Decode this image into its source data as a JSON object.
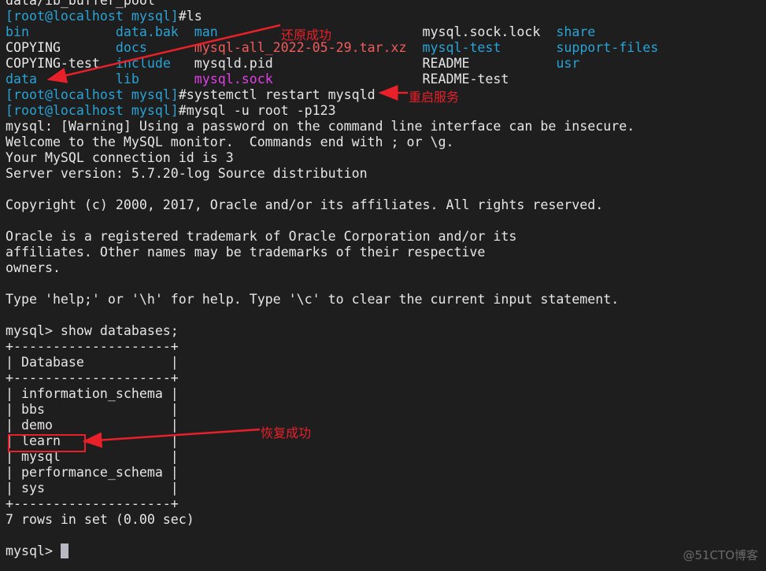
{
  "colors": {
    "background": "#1e1e1e",
    "white": "#e6e6e6",
    "blue": "#29a3d6",
    "red": "#f05c5c",
    "magenta": "#e23fe6",
    "annotation": "#e8202a"
  },
  "terminal": {
    "lines": [
      [
        [
          "data/ib_buffer_pool",
          "white"
        ]
      ],
      [
        [
          "[root@localhost mysql]",
          "blue"
        ],
        [
          "#ls",
          "white"
        ]
      ],
      [
        [
          "bin           ",
          "blue"
        ],
        [
          "data.bak  ",
          "blue"
        ],
        [
          "man                          ",
          "blue"
        ],
        [
          "mysql.sock.lock  ",
          "white"
        ],
        [
          "share",
          "blue"
        ]
      ],
      [
        [
          "COPYING       ",
          "white"
        ],
        [
          "docs      ",
          "blue"
        ],
        [
          "mysql-all_2022-05-29.tar.xz  ",
          "red"
        ],
        [
          "mysql-test       ",
          "blue"
        ],
        [
          "support-files",
          "blue"
        ]
      ],
      [
        [
          "COPYING-test  ",
          "white"
        ],
        [
          "include   ",
          "blue"
        ],
        [
          "mysqld.pid                   ",
          "white"
        ],
        [
          "README           ",
          "white"
        ],
        [
          "usr",
          "blue"
        ]
      ],
      [
        [
          "data          ",
          "blue"
        ],
        [
          "lib       ",
          "blue"
        ],
        [
          "mysql.sock                   ",
          "magenta"
        ],
        [
          "README-test",
          "white"
        ]
      ],
      [
        [
          "[root@localhost mysql]",
          "blue"
        ],
        [
          "#systemctl restart mysqld",
          "white"
        ]
      ],
      [
        [
          "[root@localhost mysql]",
          "blue"
        ],
        [
          "#mysql -u root -p123",
          "white"
        ]
      ],
      [
        [
          "mysql: [Warning] Using a password on the command line interface can be insecure.",
          "white"
        ]
      ],
      [
        [
          "Welcome to the MySQL monitor.  Commands end with ; or \\g.",
          "white"
        ]
      ],
      [
        [
          "Your MySQL connection id is 3",
          "white"
        ]
      ],
      [
        [
          "Server version: 5.7.20-log Source distribution",
          "white"
        ]
      ],
      [],
      [
        [
          "Copyright (c) 2000, 2017, Oracle and/or its affiliates. All rights reserved.",
          "white"
        ]
      ],
      [],
      [
        [
          "Oracle is a registered trademark of Oracle Corporation and/or its",
          "white"
        ]
      ],
      [
        [
          "affiliates. Other names may be trademarks of their respective",
          "white"
        ]
      ],
      [
        [
          "owners.",
          "white"
        ]
      ],
      [],
      [
        [
          "Type 'help;' or '\\h' for help. Type '\\c' to clear the current input statement.",
          "white"
        ]
      ],
      [],
      [
        [
          "mysql> show databases;",
          "white"
        ]
      ],
      [
        [
          "+--------------------+",
          "white"
        ]
      ],
      [
        [
          "| Database           |",
          "white"
        ]
      ],
      [
        [
          "+--------------------+",
          "white"
        ]
      ],
      [
        [
          "| information_schema |",
          "white"
        ]
      ],
      [
        [
          "| bbs                |",
          "white"
        ]
      ],
      [
        [
          "| demo               |",
          "white"
        ]
      ],
      [
        [
          "| learn              |",
          "white"
        ]
      ],
      [
        [
          "| mysql              |",
          "white"
        ]
      ],
      [
        [
          "| performance_schema |",
          "white"
        ]
      ],
      [
        [
          "| sys                |",
          "white"
        ]
      ],
      [
        [
          "+--------------------+",
          "white"
        ]
      ],
      [
        [
          "7 rows in set (0.00 sec)",
          "white"
        ]
      ],
      [],
      [
        [
          "mysql> ",
          "white"
        ]
      ]
    ]
  },
  "annotations": {
    "restore_success": "还原成功",
    "restart_service": "重启服务",
    "recover_success": "恢复成功"
  },
  "watermark": "@51CTO博客"
}
